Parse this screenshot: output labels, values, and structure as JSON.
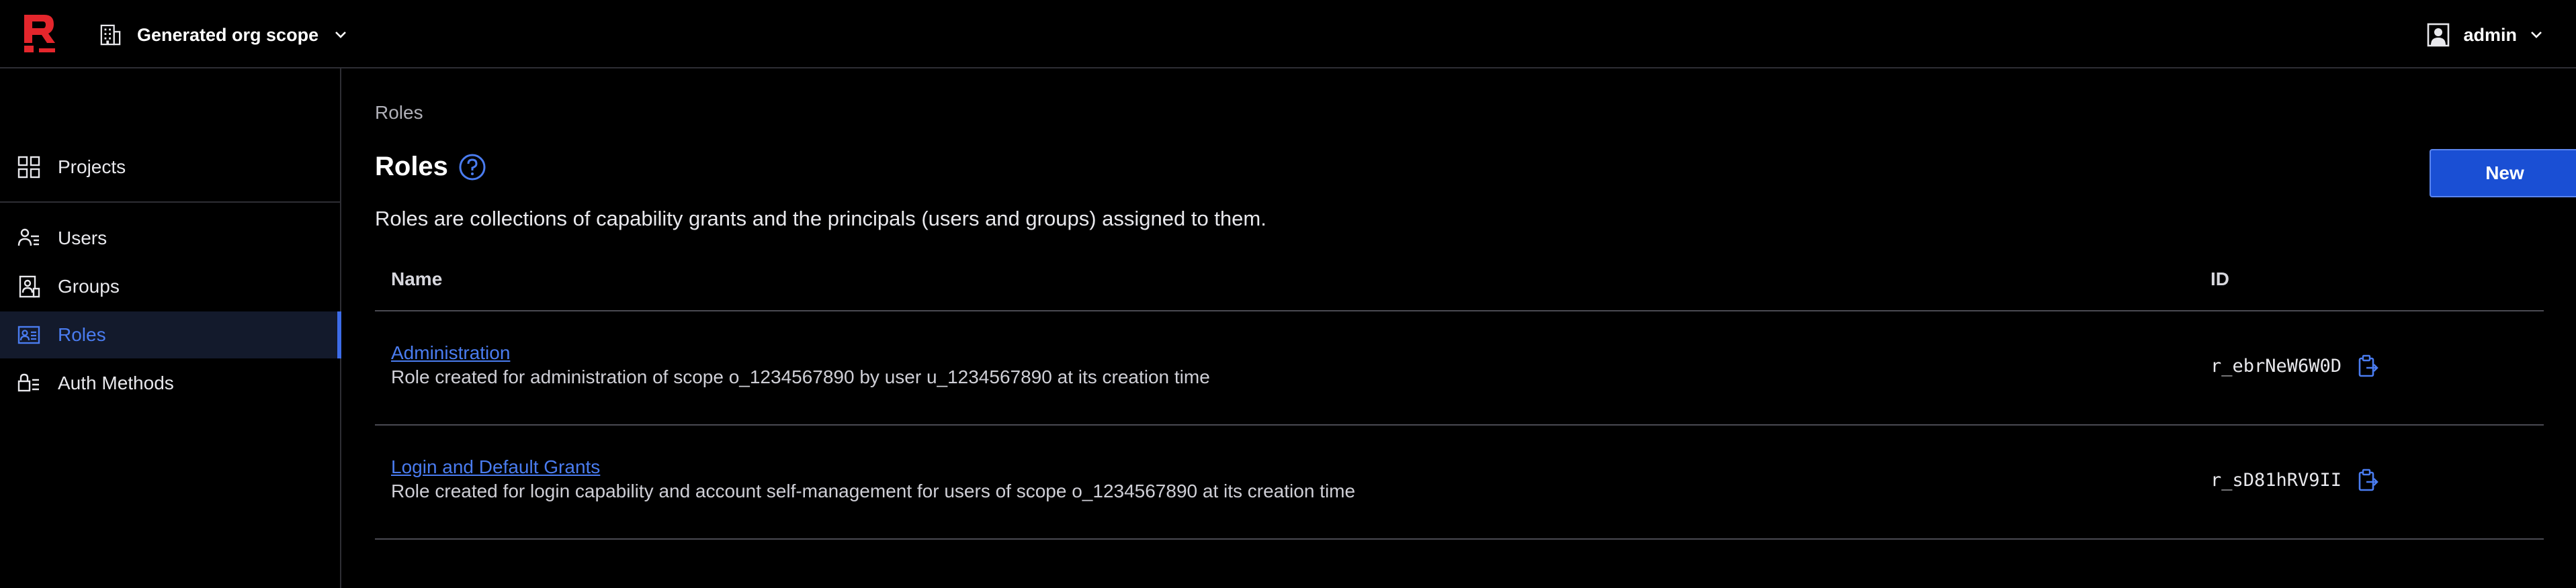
{
  "header": {
    "scope_label": "Generated org scope",
    "user_label": "admin",
    "brand_color": "#e4262c"
  },
  "sidebar": {
    "items": [
      {
        "label": "Projects",
        "icon": "grid-icon"
      },
      {
        "label": "Users",
        "icon": "users-icon"
      },
      {
        "label": "Groups",
        "icon": "groups-icon"
      },
      {
        "label": "Roles",
        "icon": "roles-icon",
        "active": true
      },
      {
        "label": "Auth Methods",
        "icon": "auth-methods-icon"
      }
    ],
    "active_color": "#4a7cf0"
  },
  "main": {
    "breadcrumb": "Roles",
    "title": "Roles",
    "description": "Roles are collections of capability grants and the principals (users and groups) assigned to them.",
    "new_button_label": "New",
    "table": {
      "columns": [
        "Name",
        "ID"
      ],
      "rows": [
        {
          "name": "Administration",
          "description": "Role created for administration of scope o_1234567890 by user u_1234567890 at its creation time",
          "id": "r_ebrNeW6W0D"
        },
        {
          "name": "Login and Default Grants",
          "description": "Role created for login capability and account self-management for users of scope o_1234567890 at its creation time",
          "id": "r_sD81hRV9II"
        }
      ]
    }
  }
}
